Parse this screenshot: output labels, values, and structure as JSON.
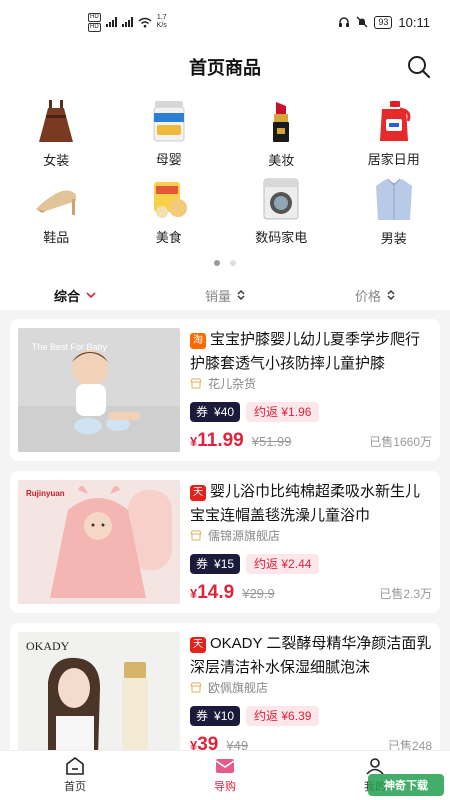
{
  "status_bar": {
    "speed_value": "1.7",
    "speed_unit": "K/s",
    "battery": "93",
    "time": "10:11",
    "icons": [
      "hd-icon",
      "signal-icon",
      "wifi-icon",
      "headphones-icon",
      "mute-icon",
      "battery-icon"
    ]
  },
  "header": {
    "title": "首页商品",
    "search_icon": "search-icon"
  },
  "categories": [
    {
      "label": "女装",
      "icon": "dress-icon"
    },
    {
      "label": "母婴",
      "icon": "milk-powder-icon"
    },
    {
      "label": "美妆",
      "icon": "lipstick-icon"
    },
    {
      "label": "居家日用",
      "icon": "detergent-icon"
    },
    {
      "label": "鞋品",
      "icon": "heels-icon"
    },
    {
      "label": "美食",
      "icon": "snack-icon"
    },
    {
      "label": "数码家电",
      "icon": "washing-machine-icon"
    },
    {
      "label": "男装",
      "icon": "shirt-icon"
    }
  ],
  "pager": {
    "pages": 2,
    "active": 0
  },
  "sort": {
    "composite": "综合",
    "sales": "销量",
    "price": "价格"
  },
  "products": [
    {
      "platform": "淘",
      "title": "宝宝护膝婴儿幼儿夏季学步爬行护膝套透气小孩防摔儿童护膝",
      "shop": "花儿杂货",
      "coupon_label": "券",
      "coupon": "¥40",
      "rebate": "约返 ¥1.96",
      "price_symbol": "¥",
      "price": "11.99",
      "old_price": "¥51.99",
      "sold": "已售1660万",
      "thumb_text": "The Best For Baby"
    },
    {
      "platform": "天猫",
      "title": "婴儿浴巾比纯棉超柔吸水新生儿宝宝连帽盖毯洗澡儿童浴巾",
      "shop": "儒锦源旗舰店",
      "coupon_label": "券",
      "coupon": "¥15",
      "rebate": "约返 ¥2.44",
      "price_symbol": "¥",
      "price": "14.9",
      "old_price": "¥29.9",
      "sold": "已售2.3万",
      "thumb_text": "Rujinyuan"
    },
    {
      "platform": "天猫",
      "title": "OKADY 二裂酵母精华净颜洁面乳深层清洁补水保湿细腻泡沫",
      "shop": "欧佩旗舰店",
      "coupon_label": "券",
      "coupon": "¥10",
      "rebate": "约返 ¥6.39",
      "price_symbol": "¥",
      "price": "39",
      "old_price": "¥49",
      "sold": "已售248",
      "thumb_text": "OKADY"
    }
  ],
  "tabbar": [
    {
      "label": "首页",
      "icon": "home-icon"
    },
    {
      "label": "导购",
      "icon": "guide-icon"
    },
    {
      "label": "我的",
      "icon": "profile-icon"
    }
  ],
  "watermark": "神奇下载",
  "colors": {
    "accent": "#e0233b",
    "coupon_bg": "#1a1a3a",
    "rebate_bg": "#fde7ea",
    "taobao": "#ff6a00",
    "tmall": "#e4231d"
  }
}
